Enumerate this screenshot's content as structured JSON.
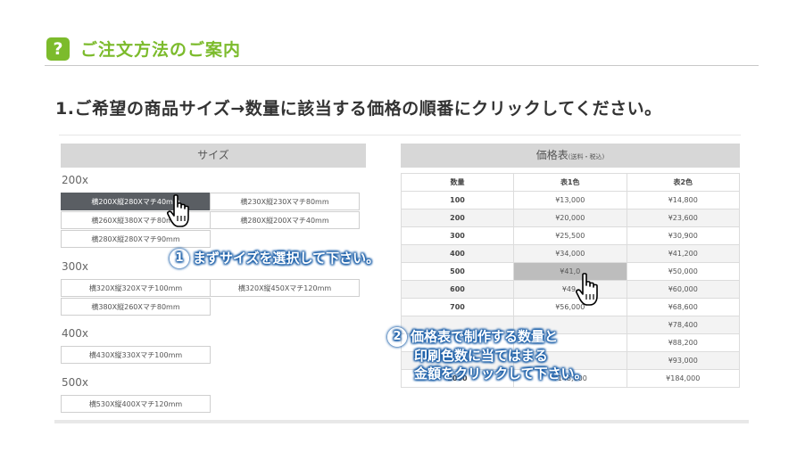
{
  "header": {
    "icon": "question-icon",
    "icon_text": "?",
    "title": "ご注文方法のご案内"
  },
  "step1": {
    "text": "1.ご希望の商品サイズ→数量に該当する価格の順番にクリックしてください。"
  },
  "size_panel": {
    "title": "サイズ",
    "groups": [
      {
        "label": "200x",
        "options": [
          "横200X縦280Xマチ40mm",
          "横230X縦230Xマチ80mm",
          "横260X縦380Xマチ80mm",
          "横280X縦200Xマチ40mm",
          "横280X縦280Xマチ90mm"
        ],
        "selected": 0
      },
      {
        "label": "300x",
        "options": [
          "横320X縦320Xマチ100mm",
          "横320X縦450Xマチ120mm",
          "横380X縦260Xマチ80mm"
        ]
      },
      {
        "label": "400x",
        "options": [
          "横430X縦330Xマチ100mm"
        ]
      },
      {
        "label": "500x",
        "options": [
          "横530X縦400Xマチ120mm"
        ]
      }
    ]
  },
  "price_panel": {
    "title": "価格表",
    "title_note": "(送料・税込)",
    "columns": [
      "数量",
      "表1色",
      "表2色"
    ],
    "rows": [
      [
        "100",
        "¥13,000",
        "¥14,800"
      ],
      [
        "200",
        "¥20,000",
        "¥23,600"
      ],
      [
        "300",
        "¥25,500",
        "¥30,900"
      ],
      [
        "400",
        "¥34,000",
        "¥41,200"
      ],
      [
        "500",
        "¥41,0",
        "¥50,000"
      ],
      [
        "600",
        "¥49,",
        "¥60,000"
      ],
      [
        "700",
        "¥56,000",
        "¥68,600"
      ],
      [
        "",
        "",
        "¥78,400"
      ],
      [
        "",
        "",
        "¥88,200"
      ],
      [
        "",
        "",
        "¥93,000"
      ],
      [
        "2000",
        "¥148,000",
        "¥184,000"
      ]
    ],
    "highlight_row": 4
  },
  "callouts": {
    "one_num": "1",
    "one_text": "まずサイズを選択して下さい。",
    "two_num": "2",
    "two_line1": "価格表で制作する数量と",
    "two_line2": "印刷色数に当てはまる",
    "two_line3": "金額をクリックして下さい。"
  },
  "colors": {
    "accent": "#7cbb2c",
    "selected": "#5a5e63",
    "callout_outline": "#1a5ea8"
  }
}
